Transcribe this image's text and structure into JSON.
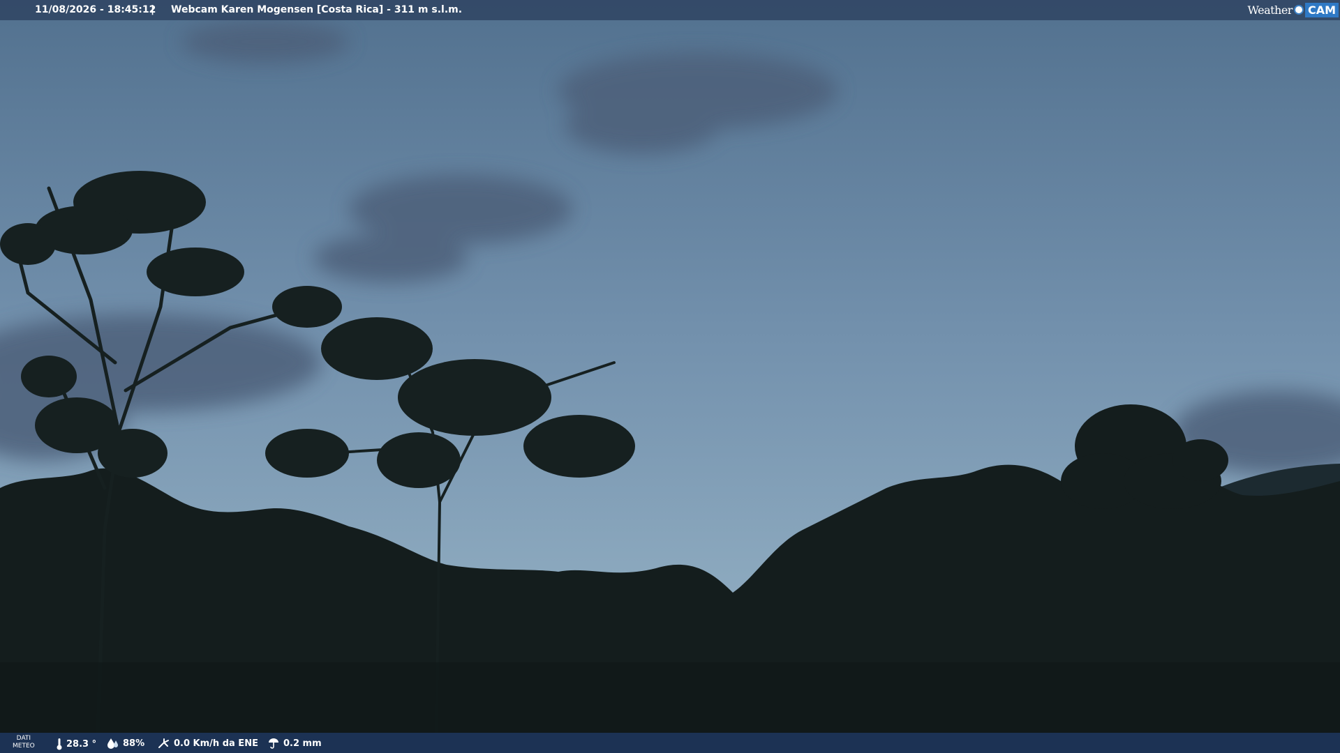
{
  "header": {
    "datetime": "11/08/2026 - 18:45:12",
    "separator": "|",
    "title": "Webcam Karen Mogensen [Costa Rica] - 311 m s.l.m.",
    "logo_weather": "Weather",
    "logo_cam": "CAM"
  },
  "weather_bar": {
    "label_line1": "DATI",
    "label_line2": "METEO",
    "temperature": "28.3 °",
    "humidity": "88%",
    "wind": "0.0 Km/h da ENE",
    "rain": "0.2 mm",
    "icons": [
      "thermometer-icon",
      "humidity-drop-icon",
      "wind-icon",
      "rain-icon"
    ]
  },
  "colors": {
    "sky_top": "#5a7a9e",
    "sky_bottom": "#7f9db7",
    "forest": "#141d1d",
    "bar": "#1e375f"
  }
}
